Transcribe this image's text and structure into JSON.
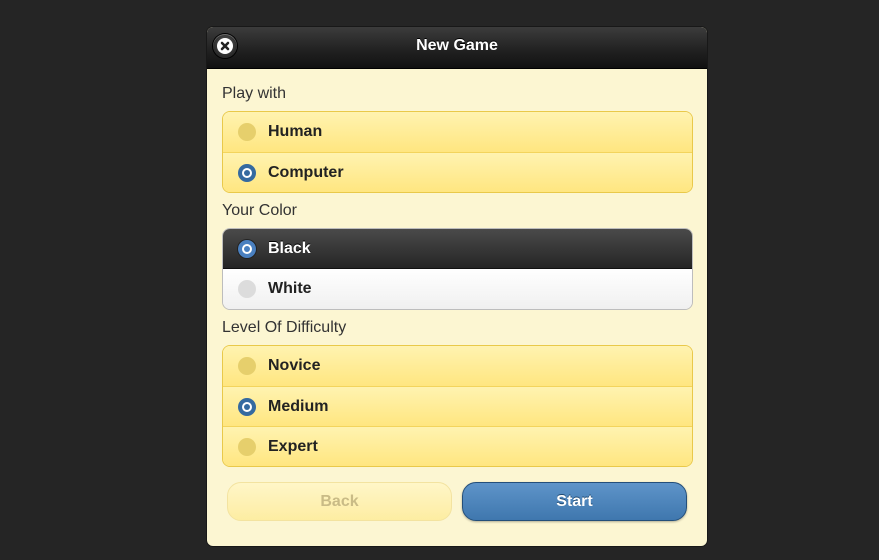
{
  "dialog": {
    "title": "New Game"
  },
  "play_with": {
    "label": "Play with",
    "options": [
      {
        "label": "Human",
        "selected": false
      },
      {
        "label": "Computer",
        "selected": true
      }
    ]
  },
  "your_color": {
    "label": "Your Color",
    "options": [
      {
        "label": "Black",
        "selected": true
      },
      {
        "label": "White",
        "selected": false
      }
    ]
  },
  "difficulty": {
    "label": "Level Of Difficulty",
    "options": [
      {
        "label": "Novice",
        "selected": false
      },
      {
        "label": "Medium",
        "selected": true
      },
      {
        "label": "Expert",
        "selected": false
      }
    ]
  },
  "buttons": {
    "back": "Back",
    "start": "Start"
  },
  "icons": {
    "close": "close-icon"
  },
  "colors": {
    "selected_radio": "#356aa0",
    "start_button": "#4a82b9",
    "panel_background": "#fcf6d2"
  }
}
